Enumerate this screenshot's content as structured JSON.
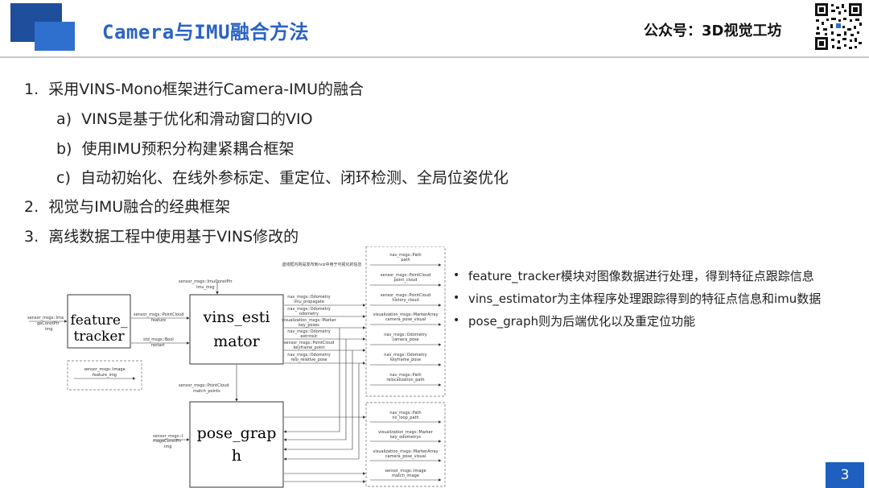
{
  "title": "Camera与IMU融合方法",
  "brand": "公众号：3D视觉工坊",
  "page_number": "3",
  "outline": [
    {
      "num": "1.",
      "text": "采用VINS-Mono框架进行Camera-IMU的融合"
    },
    {
      "num": "a)",
      "text": "VINS是基于优化和滑动窗口的VIO"
    },
    {
      "num": "b)",
      "text": "使用IMU预积分构建紧耦合框架"
    },
    {
      "num": "c)",
      "text": "自动初始化、在线外参标定、重定位、闭环检测、全局位姿优化"
    },
    {
      "num": "2.",
      "text": "视觉与IMU融合的经典框架"
    },
    {
      "num": "3.",
      "text": "离线数据工程中使用基于VINS修改的"
    }
  ],
  "bullets": [
    "feature_tracker模块对图像数据进行处理，得到特征点跟踪信息",
    "vins_estimator为主体程序处理跟踪得到的特征点信息和imu数据",
    "pose_graph则为后端优化以及重定位功能"
  ],
  "diagram": {
    "caption": "虚线框内则是发布到rviz中用于可视化的信息",
    "nodes": {
      "feature_tracker": [
        "feature_",
        "tracker"
      ],
      "vins_estimator": [
        "vins_esti",
        "mator"
      ],
      "pose_graph": [
        "pose_grap",
        "h"
      ]
    },
    "inputs": {
      "image_to_tracker": [
        "sensor_msgs::Ima",
        "geConstPtr",
        "img"
      ],
      "imu": [
        "sensor_msgs::ImuConstPtr",
        "imu_msg"
      ],
      "image_to_graph": [
        "sensor_msgs::I",
        "mageConstPtr",
        "img"
      ]
    },
    "tracker_outputs": [
      [
        "sensor_msgs::PointCloud",
        "feature"
      ],
      [
        "std_msgs::Bool",
        "restart"
      ]
    ],
    "tracker_vis": [
      "sensor_msgs::Image",
      "feature_img"
    ],
    "estimator_outputs": [
      [
        "nav_msgs::Odometry",
        "imu_propagate"
      ],
      [
        "nav_msgs::Odometry",
        "odometry"
      ],
      [
        "visualization_msgs::Marker",
        "key_poses"
      ],
      [
        "nav_msgs::Odometry",
        "extrinsic"
      ],
      [
        "sensor_msgs::PointCloud",
        "keyframe_point"
      ],
      [
        "nav_msgs::Odometry",
        "relo_relative_pose"
      ]
    ],
    "graph_input": [
      "sensor_msgs::PointCloud",
      "match_points"
    ],
    "rviz_upper": [
      [
        "nav_msgs::Path",
        "path"
      ],
      [
        "sensor_msgs::PointCloud",
        "point_cloud"
      ],
      [
        "sensor_msgs::PointCloud",
        "history_cloud"
      ],
      [
        "visualization_msgs::MarkerArray",
        "camera_pose_visual"
      ],
      [
        "nav_msgs::Odometry",
        "camera_pose"
      ],
      [
        "nav_msgs::Odometry",
        "keyframe_pose"
      ],
      [
        "nav_msgs::Path",
        "relocalization_path"
      ]
    ],
    "rviz_lower": [
      [
        "nav_msgs::Path",
        "no_loop_path"
      ],
      [
        "visualization_msgs::Marker",
        "key_odometrys"
      ],
      [
        "visualization_msgs::MarkerArray",
        "camera_pose_visual"
      ],
      [
        "sensor_msgs::Image",
        "match_image"
      ]
    ]
  }
}
